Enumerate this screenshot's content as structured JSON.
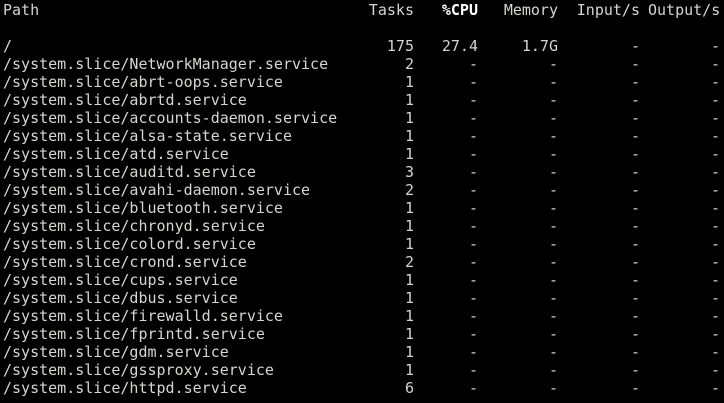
{
  "colors": {
    "background": "#000000",
    "foreground": "#d3d7cf",
    "sort_column": "#ffffff"
  },
  "header": {
    "path": "Path",
    "tasks": "Tasks",
    "cpu": "%CPU",
    "memory": "Memory",
    "input": "Input/s",
    "output": "Output/s"
  },
  "sort_column": "%CPU",
  "rows": [
    {
      "path": "/",
      "tasks": "175",
      "cpu": "27.4",
      "memory": "1.7G",
      "input": "-",
      "output": "-"
    },
    {
      "path": "/system.slice/NetworkManager.service",
      "tasks": "2",
      "cpu": "-",
      "memory": "-",
      "input": "-",
      "output": "-"
    },
    {
      "path": "/system.slice/abrt-oops.service",
      "tasks": "1",
      "cpu": "-",
      "memory": "-",
      "input": "-",
      "output": "-"
    },
    {
      "path": "/system.slice/abrtd.service",
      "tasks": "1",
      "cpu": "-",
      "memory": "-",
      "input": "-",
      "output": "-"
    },
    {
      "path": "/system.slice/accounts-daemon.service",
      "tasks": "1",
      "cpu": "-",
      "memory": "-",
      "input": "-",
      "output": "-"
    },
    {
      "path": "/system.slice/alsa-state.service",
      "tasks": "1",
      "cpu": "-",
      "memory": "-",
      "input": "-",
      "output": "-"
    },
    {
      "path": "/system.slice/atd.service",
      "tasks": "1",
      "cpu": "-",
      "memory": "-",
      "input": "-",
      "output": "-"
    },
    {
      "path": "/system.slice/auditd.service",
      "tasks": "3",
      "cpu": "-",
      "memory": "-",
      "input": "-",
      "output": "-"
    },
    {
      "path": "/system.slice/avahi-daemon.service",
      "tasks": "2",
      "cpu": "-",
      "memory": "-",
      "input": "-",
      "output": "-"
    },
    {
      "path": "/system.slice/bluetooth.service",
      "tasks": "1",
      "cpu": "-",
      "memory": "-",
      "input": "-",
      "output": "-"
    },
    {
      "path": "/system.slice/chronyd.service",
      "tasks": "1",
      "cpu": "-",
      "memory": "-",
      "input": "-",
      "output": "-"
    },
    {
      "path": "/system.slice/colord.service",
      "tasks": "1",
      "cpu": "-",
      "memory": "-",
      "input": "-",
      "output": "-"
    },
    {
      "path": "/system.slice/crond.service",
      "tasks": "2",
      "cpu": "-",
      "memory": "-",
      "input": "-",
      "output": "-"
    },
    {
      "path": "/system.slice/cups.service",
      "tasks": "1",
      "cpu": "-",
      "memory": "-",
      "input": "-",
      "output": "-"
    },
    {
      "path": "/system.slice/dbus.service",
      "tasks": "1",
      "cpu": "-",
      "memory": "-",
      "input": "-",
      "output": "-"
    },
    {
      "path": "/system.slice/firewalld.service",
      "tasks": "1",
      "cpu": "-",
      "memory": "-",
      "input": "-",
      "output": "-"
    },
    {
      "path": "/system.slice/fprintd.service",
      "tasks": "1",
      "cpu": "-",
      "memory": "-",
      "input": "-",
      "output": "-"
    },
    {
      "path": "/system.slice/gdm.service",
      "tasks": "1",
      "cpu": "-",
      "memory": "-",
      "input": "-",
      "output": "-"
    },
    {
      "path": "/system.slice/gssproxy.service",
      "tasks": "1",
      "cpu": "-",
      "memory": "-",
      "input": "-",
      "output": "-"
    },
    {
      "path": "/system.slice/httpd.service",
      "tasks": "6",
      "cpu": "-",
      "memory": "-",
      "input": "-",
      "output": "-"
    }
  ]
}
